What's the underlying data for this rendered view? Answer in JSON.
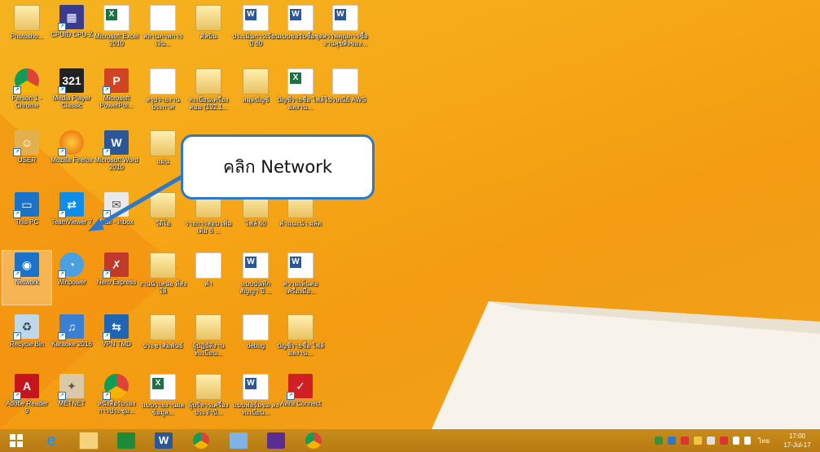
{
  "desktop": {
    "icons": [
      {
        "label": "Photosho...",
        "kind": "folder"
      },
      {
        "label": "CPUID CPU-Z",
        "kind": "cpuz"
      },
      {
        "label": "Microsoft Excel 2010",
        "kind": "excel"
      },
      {
        "label": "สถานภาพการเงิน...",
        "kind": "doc"
      },
      {
        "label": "ศิลปิน",
        "kind": "folder"
      },
      {
        "label": "ประเมินการเรียน ปี 60",
        "kind": "word"
      },
      {
        "label": "แบบขอรับซื้อชุด",
        "kind": "word"
      },
      {
        "label": "สรรพคุณการซื้อ งานสุขสิ่งของ...",
        "kind": "word"
      },
      {
        "label": "Person 1 - Chrome",
        "kind": "chrome"
      },
      {
        "label": "Media Player Classic",
        "kind": "mpc"
      },
      {
        "label": "Microsoft PowerPoi...",
        "kind": "ppt"
      },
      {
        "label": "สรุปรายงานประกาศ",
        "kind": "doc"
      },
      {
        "label": "ทะเบียนเครื่อง คอม (192.1...",
        "kind": "folder"
      },
      {
        "label": "สมุดบัญชี",
        "kind": "folder"
      },
      {
        "label": "บัญชีรายชื่อ ไฟล์ผลงาน...",
        "kind": "excel"
      },
      {
        "label": "ไปรษณีย์ AWS",
        "kind": "doc"
      },
      {
        "label": "USER",
        "kind": "user"
      },
      {
        "label": "Mozilla Firefox",
        "kind": "firefox"
      },
      {
        "label": "Microsoft Word 2010",
        "kind": "wordapp"
      },
      {
        "label": "แผ่น",
        "kind": "folder"
      },
      {
        "label": "This PC",
        "kind": "pc"
      },
      {
        "label": "TeamViewer 7",
        "kind": "teamviewer"
      },
      {
        "label": "Mail - Inbox",
        "kind": "mail"
      },
      {
        "label": "วีดีโอ",
        "kind": "folder"
      },
      {
        "label": "รายการสอบ เพิ่มเติม 6 ...",
        "kind": "folder"
      },
      {
        "label": "ไฟล์ 60",
        "kind": "folder"
      },
      {
        "label": "คำแนะนำ ผลิต",
        "kind": "folder"
      },
      {
        "label": "Network",
        "kind": "network"
      },
      {
        "label": "Winpower",
        "kind": "winpower"
      },
      {
        "label": "Nero Express",
        "kind": "nero"
      },
      {
        "label": "งานนำเสนอ ที่ส่งให้",
        "kind": "folder"
      },
      {
        "label": "คำ",
        "kind": "doc"
      },
      {
        "label": "แบบบันทึกสัญญา ปี ...",
        "kind": "word"
      },
      {
        "label": "ความเห็นต่อ เครื่องมือ...",
        "kind": "word"
      },
      {
        "label": "Recycle Bin",
        "kind": "recycle"
      },
      {
        "label": "Karaoke 2016",
        "kind": "karaoke"
      },
      {
        "label": "VPN TMD",
        "kind": "vpn"
      },
      {
        "label": "ประชาสัมพันธ์",
        "kind": "folder"
      },
      {
        "label": "ผู้ปฏิบัติงาน ทะเบียน...",
        "kind": "folder"
      },
      {
        "label": "debug",
        "kind": "doc"
      },
      {
        "label": "บัญชีรายชื่อ ไฟล์ผลงาน...",
        "kind": "folder"
      },
      {
        "label": "Adobe Reader 9",
        "kind": "adobe"
      },
      {
        "label": "METNET",
        "kind": "metnet"
      },
      {
        "label": "หนังสือรับรอง การประชุม...",
        "kind": "chrome"
      },
      {
        "label": "แบบรายงานผล ข้อมูล...",
        "kind": "excel"
      },
      {
        "label": "ผู้บริหารเครื่อง ประจำปี...",
        "kind": "folder"
      },
      {
        "label": "แบบฟอร์มขอ ลงทะเบียน...",
        "kind": "word"
      },
      {
        "label": "Avira Connect",
        "kind": "avira"
      }
    ]
  },
  "callout": {
    "text": "คลิก Network"
  },
  "taskbar": {
    "apps": [
      {
        "name": "ie"
      },
      {
        "name": "explorer"
      },
      {
        "name": "store"
      },
      {
        "name": "word"
      },
      {
        "name": "chrome"
      },
      {
        "name": "control"
      },
      {
        "name": "settings"
      },
      {
        "name": "person"
      }
    ],
    "language": "ไทย",
    "time": "17:00",
    "date": "17-Jul-17"
  },
  "colors": {
    "accent": "#2e78c7",
    "desktop": "#f6a817",
    "taskbar": "#b67a12"
  }
}
